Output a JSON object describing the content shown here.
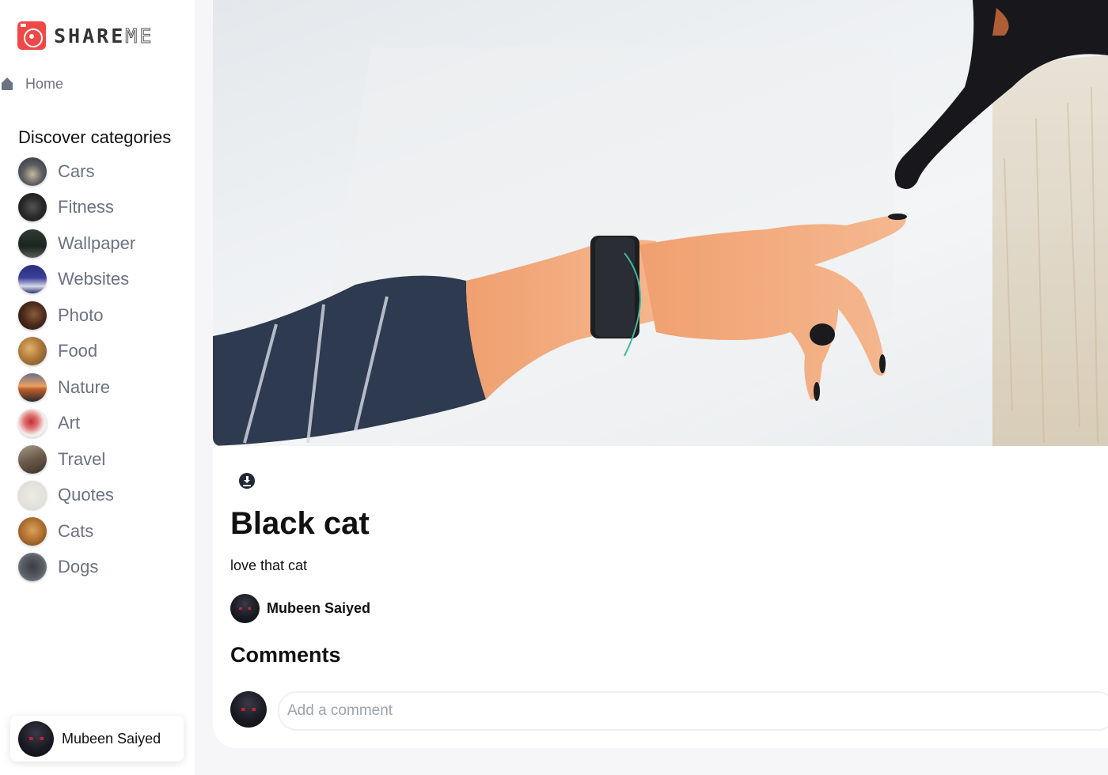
{
  "app": {
    "logo_text_bold": "SHARE",
    "logo_text_light": "ME",
    "brand_color": "#f04848"
  },
  "sidebar": {
    "home_label": "Home",
    "discover_title": "Discover categories",
    "categories": [
      {
        "label": "Cars"
      },
      {
        "label": "Fitness"
      },
      {
        "label": "Wallpaper"
      },
      {
        "label": "Websites"
      },
      {
        "label": "Photo"
      },
      {
        "label": "Food"
      },
      {
        "label": "Nature"
      },
      {
        "label": "Art"
      },
      {
        "label": "Travel"
      },
      {
        "label": "Quotes"
      },
      {
        "label": "Cats"
      },
      {
        "label": "Dogs"
      }
    ],
    "user_name": "Mubeen Saiyed"
  },
  "pin": {
    "title": "Black cat",
    "description": "love that cat",
    "author_name": "Mubeen Saiyed"
  },
  "comments": {
    "title": "Comments",
    "input_placeholder": "Add a comment"
  }
}
